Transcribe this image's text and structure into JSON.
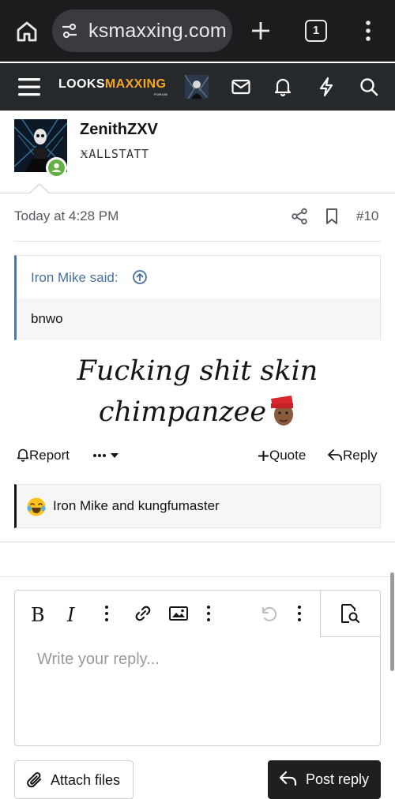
{
  "browser": {
    "url": "ksmaxxing.com",
    "tab_count": "1",
    "icons": [
      "home-icon",
      "site-settings-icon",
      "new-tab-icon",
      "tab-count-icon",
      "more-vert-icon"
    ]
  },
  "site": {
    "logo_main": "LOOKS",
    "logo_accent": "MAXXING",
    "logo_sub": "FORUM",
    "accent_color": "#f6a623",
    "header_icons": [
      "menu-icon",
      "user-avatar",
      "mail-icon",
      "bell-icon",
      "bolt-icon",
      "search-icon"
    ]
  },
  "post": {
    "author": "ZenithZXV",
    "author_title": "ӾALLSTATT",
    "date": "Today at 4:28 PM",
    "number": "#10",
    "quote": {
      "author": "Iron Mike said:",
      "text": "bnwo"
    },
    "body_line1": "Fucking shit skin",
    "body_line2": "chimpanzee",
    "actions": {
      "report": "Report",
      "quote": "Quote",
      "reply": "Reply"
    },
    "reactions": "Iron Mike and kungfumaster"
  },
  "editor": {
    "bold": "B",
    "italic": "I",
    "placeholder": "Write your reply...",
    "attach_label": "Attach files",
    "post_label": "Post reply"
  }
}
